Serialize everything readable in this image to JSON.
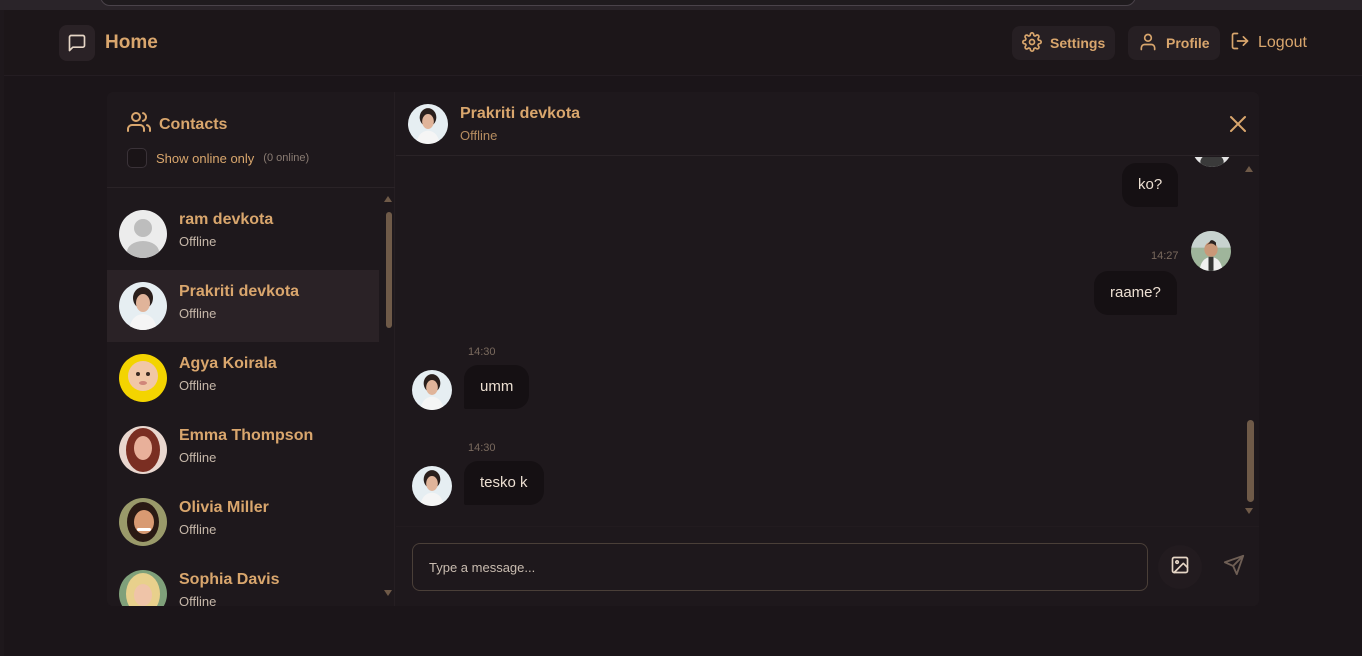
{
  "navbar": {
    "title": "Home",
    "settings_label": "Settings",
    "profile_label": "Profile",
    "logout_label": "Logout"
  },
  "sidebar": {
    "title": "Contacts",
    "online_toggle_label": "Show online only",
    "online_count": "(0 online)",
    "contacts": [
      {
        "name": "ram devkota",
        "status": "Offline"
      },
      {
        "name": "Prakriti devkota",
        "status": "Offline",
        "active": true
      },
      {
        "name": "Agya Koirala",
        "status": "Offline"
      },
      {
        "name": "Emma Thompson",
        "status": "Offline"
      },
      {
        "name": "Olivia Miller",
        "status": "Offline"
      },
      {
        "name": "Sophia Davis",
        "status": "Offline"
      }
    ]
  },
  "chat": {
    "name": "Prakriti devkota",
    "status": "Offline",
    "messages": [
      {
        "direction": "out",
        "text": "ko?"
      },
      {
        "direction": "out",
        "time": "14:27",
        "text": "raame?"
      },
      {
        "direction": "in",
        "time": "14:30",
        "text": "umm"
      },
      {
        "direction": "in",
        "time": "14:30",
        "text": "tesko k"
      }
    ]
  },
  "composer": {
    "placeholder": "Type a message..."
  },
  "colors": {
    "accent": "#d9a66d",
    "background": "#1b1519",
    "bubble": "#151013"
  }
}
